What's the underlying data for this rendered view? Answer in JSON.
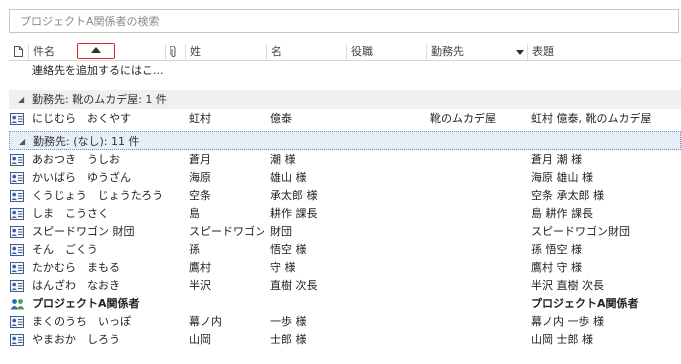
{
  "search": {
    "placeholder": "プロジェクトA関係者の検索"
  },
  "columns": {
    "name": "件名",
    "sei": "姓",
    "mei": "名",
    "role": "役職",
    "company": "勤務先",
    "title": "表題"
  },
  "add_hint": "連絡先を追加するにはこ...",
  "groups": [
    {
      "label": "勤務先: 靴のムカデ屋: 1 件"
    },
    {
      "label": "勤務先: (なし): 11 件"
    }
  ],
  "rows": [
    {
      "icon": "contact-card-icon",
      "name": "にじむら　おくやす",
      "sei": "虹村",
      "mei": "億泰",
      "company": "靴のムカデ屋",
      "title": "虹村 億泰, 靴のムカデ屋"
    },
    {
      "icon": "contact-card-icon",
      "name": "あおつき　うしお",
      "sei": "蒼月",
      "mei": "潮 様",
      "company": "",
      "title": "蒼月 潮 様"
    },
    {
      "icon": "contact-card-icon",
      "name": "かいばら　ゆうざん",
      "sei": "海原",
      "mei": "雄山 様",
      "company": "",
      "title": "海原 雄山 様"
    },
    {
      "icon": "contact-card-icon",
      "name": "くうじょう　じょうたろう",
      "sei": "空条",
      "mei": "承太郎 様",
      "company": "",
      "title": "空条 承太郎 様"
    },
    {
      "icon": "contact-card-icon",
      "name": "しま　こうさく",
      "sei": "島",
      "mei": "耕作 課長",
      "company": "",
      "title": "島 耕作 課長"
    },
    {
      "icon": "contact-card-icon",
      "name": "スピードワゴン 財団",
      "sei": "スピードワゴン",
      "mei": "財団",
      "company": "",
      "title": "スピードワゴン財団"
    },
    {
      "icon": "contact-card-icon",
      "name": "そん　ごくう",
      "sei": "孫",
      "mei": "悟空 様",
      "company": "",
      "title": "孫 悟空 様"
    },
    {
      "icon": "contact-card-icon",
      "name": "たかむら　まもる",
      "sei": "鷹村",
      "mei": "守 様",
      "company": "",
      "title": "鷹村 守 様"
    },
    {
      "icon": "contact-card-icon",
      "name": "はんざわ　なおき",
      "sei": "半沢",
      "mei": "直樹 次長",
      "company": "",
      "title": "半沢 直樹 次長"
    },
    {
      "icon": "contact-group-icon",
      "name": "プロジェクトA関係者",
      "sei": "",
      "mei": "",
      "company": "",
      "title": "プロジェクトA関係者",
      "bold": true
    },
    {
      "icon": "contact-card-icon",
      "name": "まくのうち　いっぽ",
      "sei": "幕ノ内",
      "mei": "一歩 様",
      "company": "",
      "title": "幕ノ内 一歩 様"
    },
    {
      "icon": "contact-card-icon",
      "name": "やまおか　しろう",
      "sei": "山岡",
      "mei": "士郎 様",
      "company": "",
      "title": "山岡 士郎 様"
    }
  ]
}
